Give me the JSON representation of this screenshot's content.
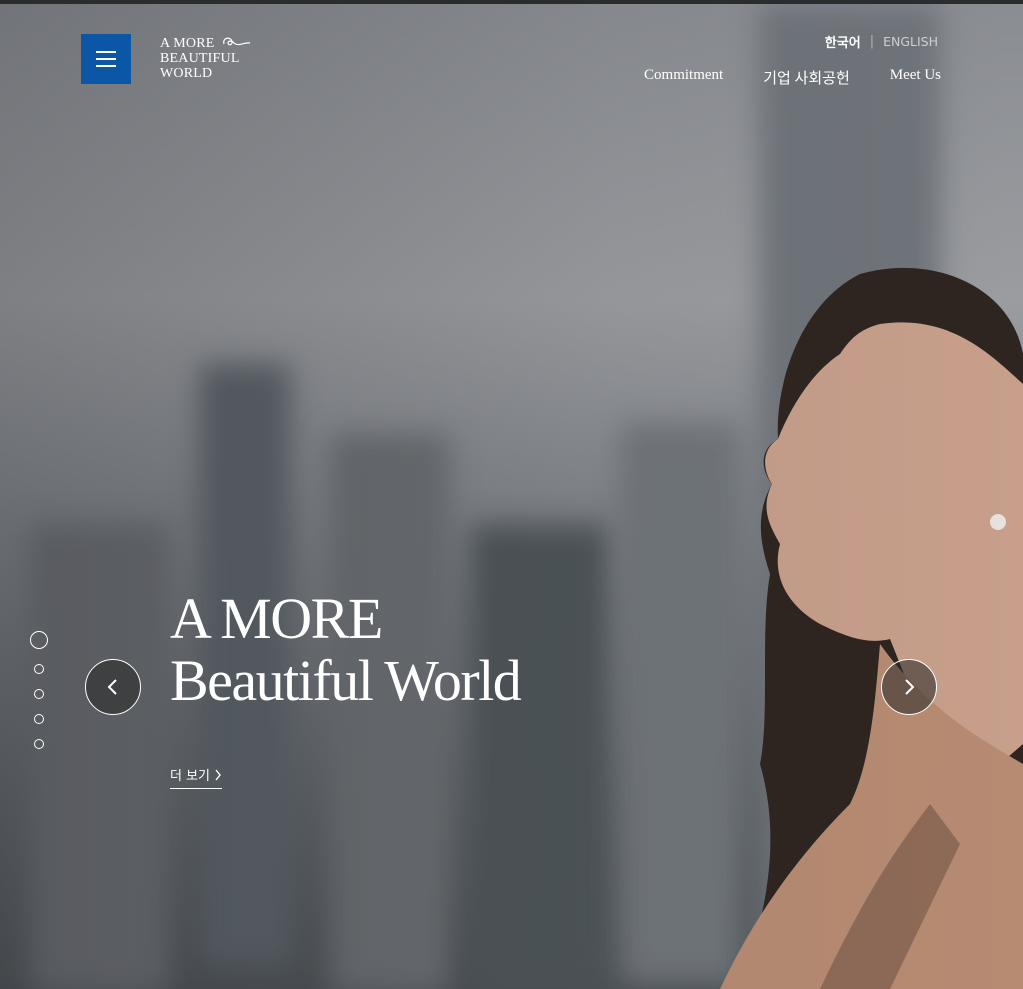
{
  "logo": {
    "line1": "A MORE",
    "line2": "BEAUTIFUL",
    "line3": "WORLD"
  },
  "header": {
    "menu_icon": "hamburger-icon",
    "lang": {
      "korean": "한국어",
      "separator": "|",
      "english": "ENGLISH"
    },
    "nav": [
      {
        "label": "Commitment"
      },
      {
        "label": "기업 사회공헌"
      },
      {
        "label": "Meet Us"
      }
    ]
  },
  "hero": {
    "title_line1": "A MORE",
    "title_line2": "Beautiful World",
    "more_label": "더 보기",
    "more_icon": "chevron-right-icon",
    "prev_icon": "chevron-left-icon",
    "next_icon": "chevron-right-icon"
  },
  "pagination": {
    "total": 5,
    "active": 1
  },
  "colors": {
    "accent": "#0b56a5",
    "text": "#ffffff"
  }
}
